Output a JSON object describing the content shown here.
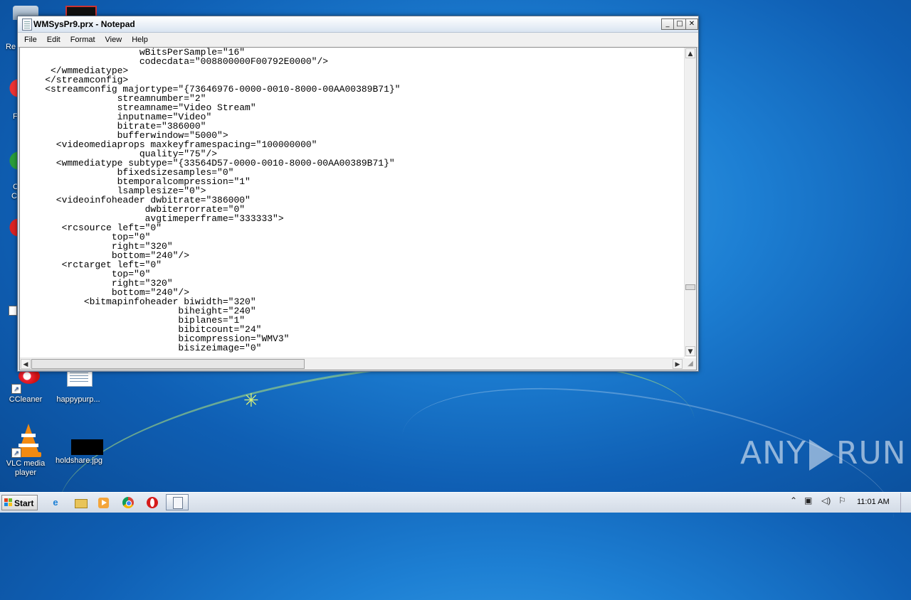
{
  "desktop": {
    "icons": [
      {
        "label": "CCleaner",
        "icon": "ccleaner-icon"
      },
      {
        "label": "happypurp...",
        "icon": "text-file-icon"
      },
      {
        "label": "VLC media player",
        "icon": "vlc-cone-icon"
      },
      {
        "label": "holdshare.jpg",
        "icon": "image-file-icon"
      }
    ],
    "partial_labels": [
      "Re",
      "F",
      "C",
      "C"
    ],
    "watermark": {
      "left": "ANY",
      "right": "RUN"
    }
  },
  "window": {
    "title": "WMSysPr9.prx - Notepad",
    "controls": {
      "minimize": "_",
      "maximize": "□",
      "close": "✕"
    },
    "menu": [
      "File",
      "Edit",
      "Format",
      "View",
      "Help"
    ],
    "content": "                     wBitsPerSample=\"16\"\n                     codecdata=\"008800000F00792E0000\"/>\n     </wmmediatype>\n    </streamconfig>\n    <streamconfig majortype=\"{73646976-0000-0010-8000-00AA00389B71}\"\n                 streamnumber=\"2\"\n                 streamname=\"Video Stream\"\n                 inputname=\"Video\"\n                 bitrate=\"386000\"\n                 bufferwindow=\"5000\">\n      <videomediaprops maxkeyframespacing=\"100000000\"\n                     quality=\"75\"/>\n      <wmmediatype subtype=\"{33564D57-0000-0010-8000-00AA00389B71}\"\n                 bfixedsizesamples=\"0\"\n                 btemporalcompression=\"1\"\n                 lsamplesize=\"0\">\n      <videoinfoheader dwbitrate=\"386000\"\n                      dwbiterrorrate=\"0\"\n                      avgtimeperframe=\"333333\">\n       <rcsource left=\"0\"\n                top=\"0\"\n                right=\"320\"\n                bottom=\"240\"/>\n       <rctarget left=\"0\"\n                top=\"0\"\n                right=\"320\"\n                bottom=\"240\"/>\n           <bitmapinfoheader biwidth=\"320\"\n                            biheight=\"240\"\n                            biplanes=\"1\"\n                            bibitcount=\"24\"\n                            bicompression=\"WMV3\"\n                            bisizeimage=\"0\"",
    "scrollbar": {
      "vertical_position": 0.77,
      "horizontal_visible_fraction": 0.43
    }
  },
  "taskbar": {
    "start_label": "Start",
    "pinned": [
      {
        "icon": "internet-explorer-icon"
      },
      {
        "icon": "file-explorer-icon"
      },
      {
        "icon": "media-player-icon"
      },
      {
        "icon": "chrome-icon"
      },
      {
        "icon": "opera-icon"
      },
      {
        "icon": "notepad-icon"
      }
    ],
    "clock": "11:01 AM"
  },
  "colors": {
    "desktop_blue": "#1d7fd3",
    "titlebar": "#d9e4f1",
    "taskbar": "#d3dbe6"
  }
}
